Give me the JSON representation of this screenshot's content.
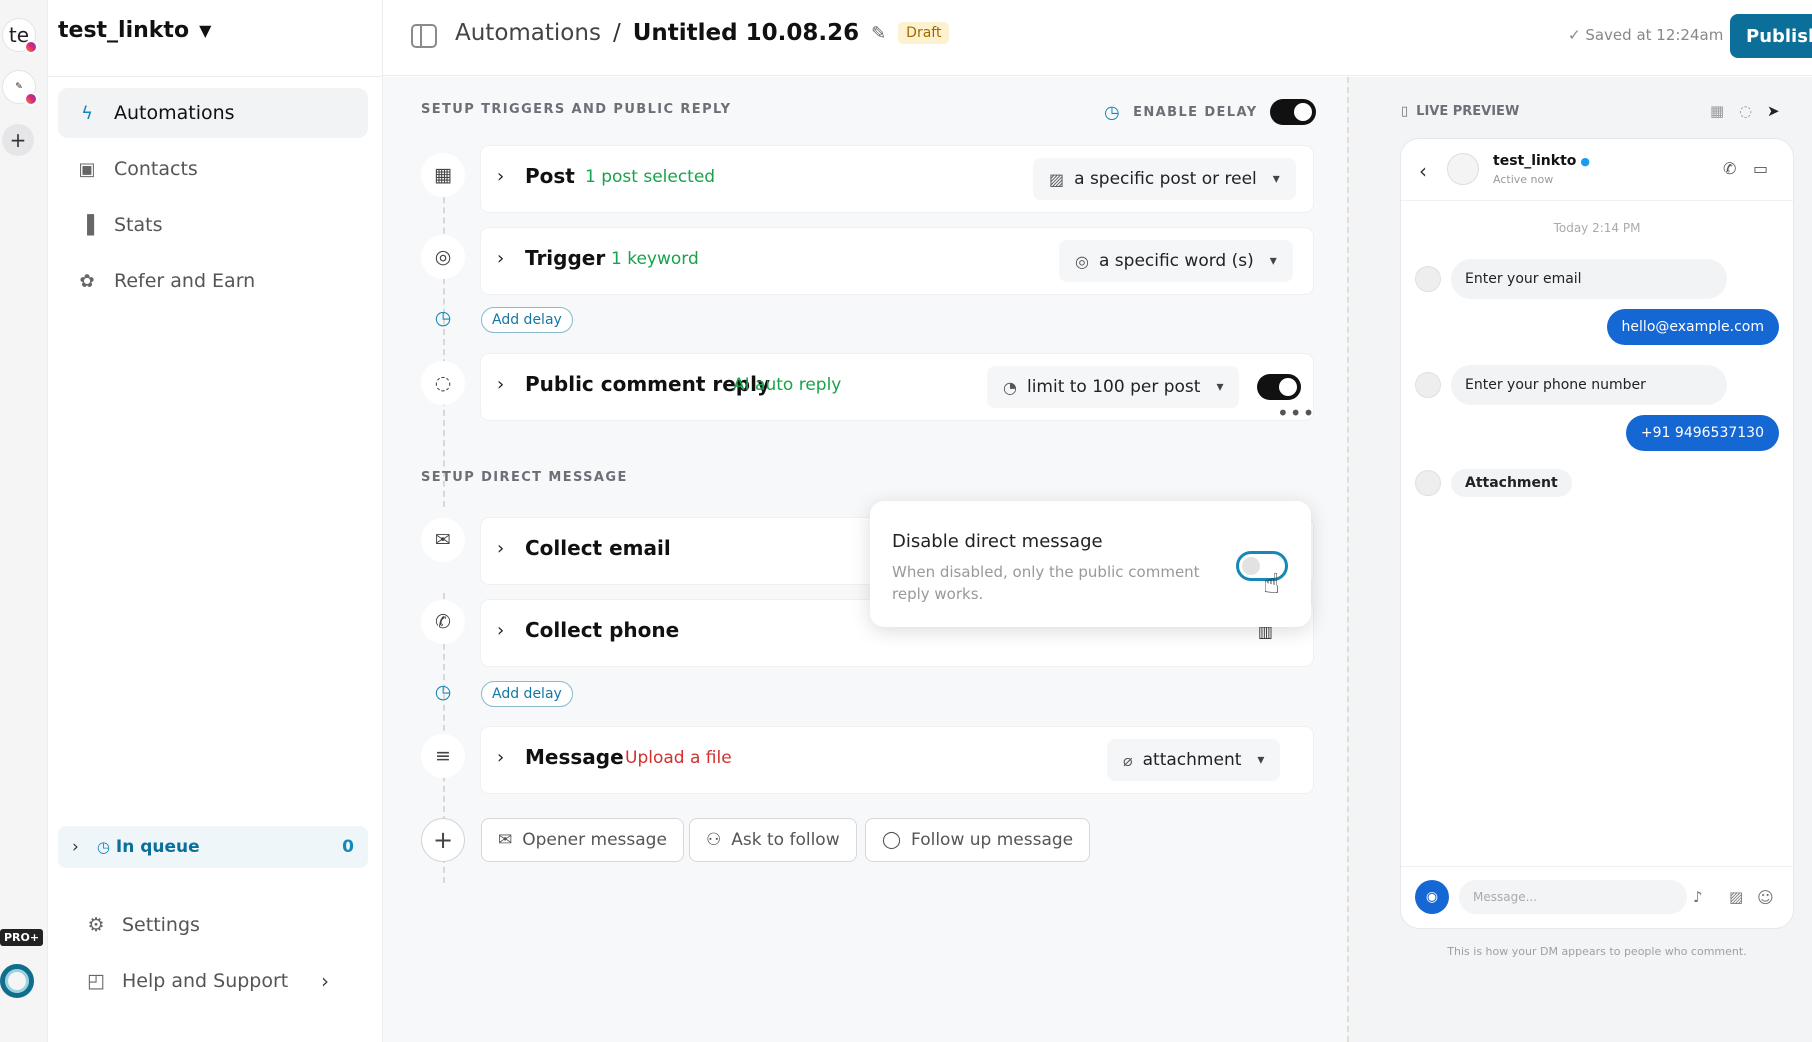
{
  "rail": {
    "avatar1": "te",
    "pro_badge": "PRO+"
  },
  "sidebar": {
    "account": "test_linkto",
    "nav": [
      {
        "label": "Automations",
        "icon": "bolt-icon"
      },
      {
        "label": "Contacts",
        "icon": "contact-icon"
      },
      {
        "label": "Stats",
        "icon": "stats-icon"
      },
      {
        "label": "Refer and Earn",
        "icon": "gift-icon"
      }
    ],
    "queue": {
      "label": "In queue",
      "count": "0"
    },
    "settings": "Settings",
    "help": "Help and Support"
  },
  "topbar": {
    "crumb": "Automations",
    "separator": "/",
    "title": "Untitled 10.08.26",
    "badge": "Draft",
    "saved": "Saved at 12:24am",
    "publish": "Publish"
  },
  "triggers": {
    "heading": "SETUP TRIGGERS AND PUBLIC REPLY",
    "delay_label": "ENABLE DELAY",
    "post": {
      "title": "Post",
      "status": "1 post selected",
      "select": "a specific post or reel"
    },
    "trigger": {
      "title": "Trigger",
      "status": "1 keyword",
      "select": "a specific word (s)"
    },
    "add_delay": "Add delay",
    "reply": {
      "title": "Public comment reply",
      "status": "AI auto reply",
      "select": "limit to 100 per post"
    }
  },
  "dm": {
    "heading": "SETUP DIRECT MESSAGE",
    "email": {
      "title": "Collect email"
    },
    "phone": {
      "title": "Collect phone"
    },
    "add_delay": "Add delay",
    "message": {
      "title": "Message",
      "status": "Upload a file",
      "select": "attachment"
    },
    "chips": [
      "Opener message",
      "Ask to follow",
      "Follow up message"
    ]
  },
  "popover": {
    "title": "Disable direct message",
    "desc": "When disabled, only the public comment reply works."
  },
  "preview": {
    "heading": "LIVE PREVIEW",
    "name": "test_linkto",
    "status": "Active now",
    "time": "Today 2:14 PM",
    "messages": [
      {
        "from": "bot",
        "text": "Enter your email"
      },
      {
        "from": "user",
        "text": "hello@example.com"
      },
      {
        "from": "bot",
        "text": "Enter your phone number"
      },
      {
        "from": "user",
        "text": "+91 9496537130"
      },
      {
        "from": "bot",
        "text": "Attachment"
      }
    ],
    "placeholder": "Message...",
    "note": "This is how your DM appears to people who comment."
  },
  "colors": {
    "accent": "#0b6f9a",
    "success": "#16a34a",
    "danger": "#d32f2f",
    "bubble_out": "#1567d3"
  }
}
